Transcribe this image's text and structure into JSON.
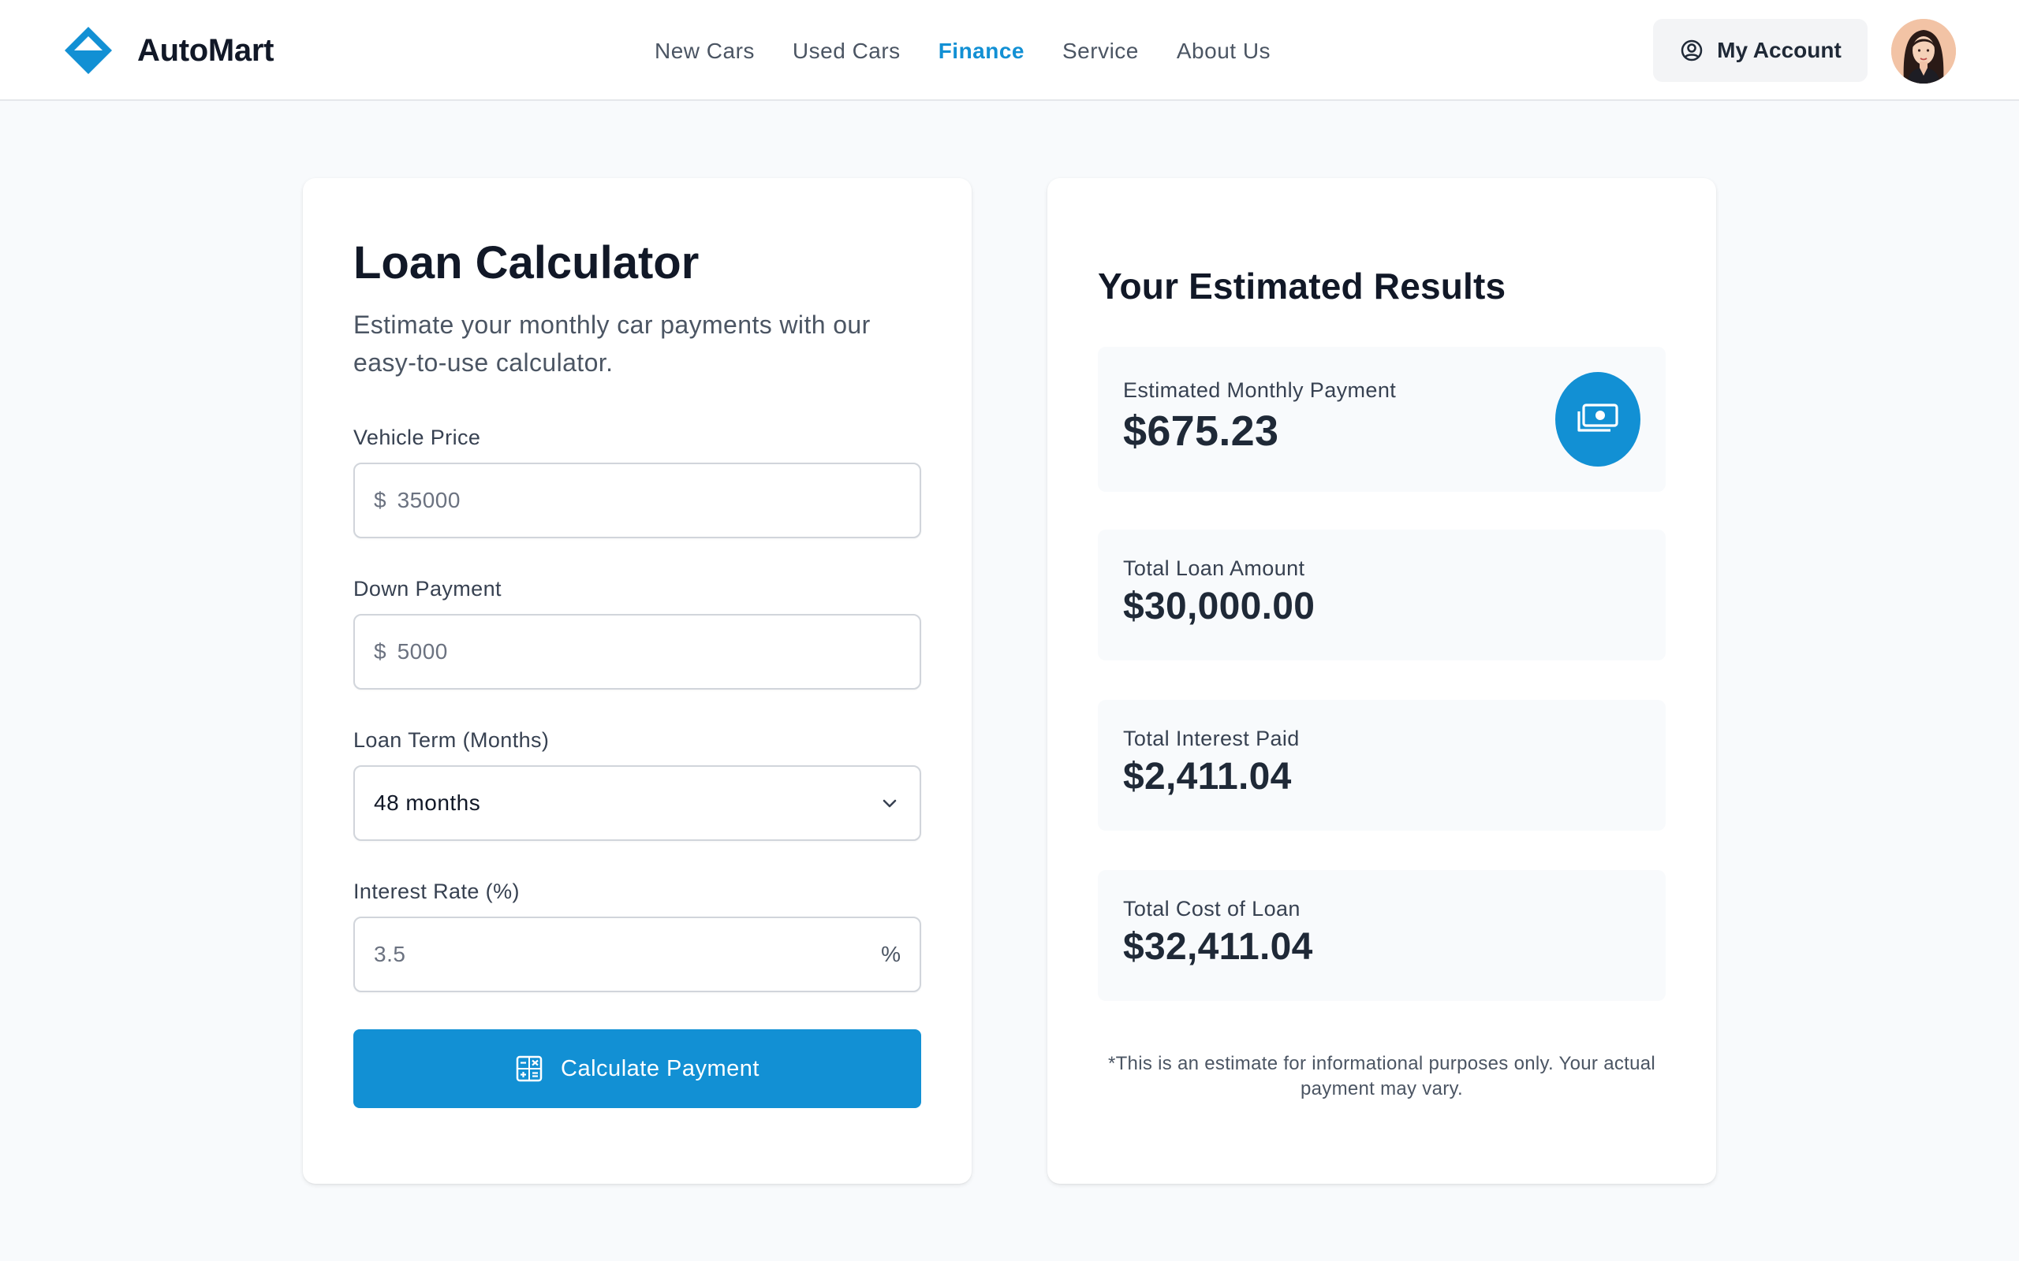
{
  "header": {
    "brand": "AutoMart",
    "nav": [
      {
        "label": "New Cars",
        "active": false
      },
      {
        "label": "Used Cars",
        "active": false
      },
      {
        "label": "Finance",
        "active": true
      },
      {
        "label": "Service",
        "active": false
      },
      {
        "label": "About Us",
        "active": false
      }
    ],
    "account_label": "My Account",
    "accent_color": "#1290d4"
  },
  "calculator": {
    "title": "Loan Calculator",
    "subtitle": "Estimate your monthly car payments with our easy-to-use calculator.",
    "vehicle_price": {
      "label": "Vehicle Price",
      "prefix": "$",
      "value": "35000"
    },
    "down_payment": {
      "label": "Down Payment",
      "prefix": "$",
      "value": "5000"
    },
    "loan_term": {
      "label": "Loan Term (Months)",
      "value": "48 months"
    },
    "interest_rate": {
      "label": "Interest Rate (%)",
      "value": "3.5",
      "suffix": "%"
    },
    "button_label": "Calculate Payment"
  },
  "results": {
    "title": "Your Estimated Results",
    "monthly_payment": {
      "label": "Estimated Monthly Payment",
      "value": "$675.23"
    },
    "loan_amount": {
      "label": "Total Loan Amount",
      "value": "$30,000.00"
    },
    "interest_paid": {
      "label": "Total Interest Paid",
      "value": "$2,411.04"
    },
    "total_cost": {
      "label": "Total Cost of Loan",
      "value": "$32,411.04"
    },
    "disclaimer": "*This is an estimate for informational purposes only. Your actual payment may vary."
  }
}
